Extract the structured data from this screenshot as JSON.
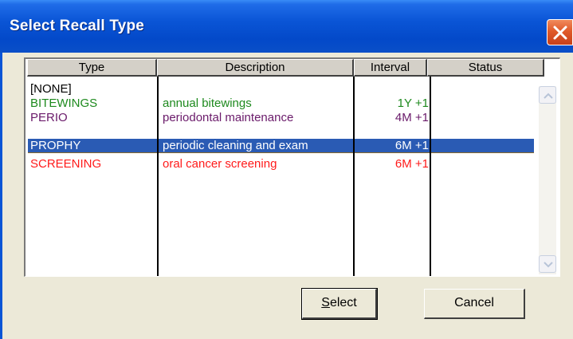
{
  "window": {
    "title": "Select Recall Type"
  },
  "columns": [
    "Type",
    "Description",
    "Interval",
    "Status"
  ],
  "rows": [
    {
      "type": "[NONE]",
      "description": "",
      "interval": "",
      "status": "",
      "color": "#000000"
    },
    {
      "type": "BITEWINGS",
      "description": "annual bitewings",
      "interval": "1Y +1",
      "status": "",
      "color": "#1e8a1e"
    },
    {
      "type": "PERIO",
      "description": "periodontal maintenance",
      "interval": "4M +1",
      "status": "",
      "color": "#6a1a6a"
    },
    {
      "type": "PROPHY",
      "description": "periodic cleaning and exam",
      "interval": "6M +1",
      "status": "",
      "color": "#ffffff",
      "selected": true
    },
    {
      "type": "SCREENING",
      "description": "oral cancer screening",
      "interval": "6M +1",
      "status": "",
      "color": "#ff1a1a"
    }
  ],
  "buttons": {
    "select_accel": "S",
    "select_rest": "elect",
    "cancel": "Cancel"
  },
  "icons": {
    "close": "close-icon",
    "scroll_up": "chevron-up-icon",
    "scroll_down": "chevron-down-icon"
  }
}
